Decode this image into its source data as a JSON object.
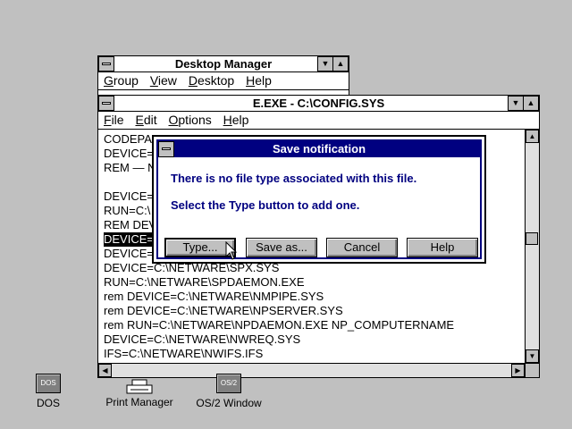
{
  "desktop_manager": {
    "title": "Desktop Manager",
    "menu": [
      "Group",
      "View",
      "Desktop",
      "Help"
    ]
  },
  "editor": {
    "title": "E.EXE - C:\\CONFIG.SYS",
    "menu": [
      "File",
      "Edit",
      "Options",
      "Help"
    ],
    "lines": [
      "CODEPA",
      "DEVICE=",
      "REM — N",
      "",
      "DEVICE=",
      "RUN=C:\\",
      "REM DEV",
      "DEVICE=",
      "DEVICE=",
      "DEVICE=C:\\NETWARE\\SPX.SYS",
      "RUN=C:\\NETWARE\\SPDAEMON.EXE",
      "rem DEVICE=C:\\NETWARE\\NMPIPE.SYS",
      "rem DEVICE=C:\\NETWARE\\NPSERVER.SYS",
      "rem RUN=C:\\NETWARE\\NPDAEMON.EXE NP_COMPUTERNAME",
      "DEVICE=C:\\NETWARE\\NWREQ.SYS",
      "IFS=C:\\NETWARE\\NWIFS.IFS"
    ],
    "selected_line_index": 7
  },
  "dialog": {
    "title": "Save notification",
    "message1": "There is no file type associated with this file.",
    "message2": "Select the Type button to add one.",
    "buttons": [
      "Type...",
      "Save as...",
      "Cancel",
      "Help"
    ]
  },
  "desktop_icons": [
    {
      "label": "DOS",
      "badge": "DOS"
    },
    {
      "label": "Print Manager",
      "badge": ""
    },
    {
      "label": "OS/2 Window",
      "badge": "OS/2"
    }
  ]
}
